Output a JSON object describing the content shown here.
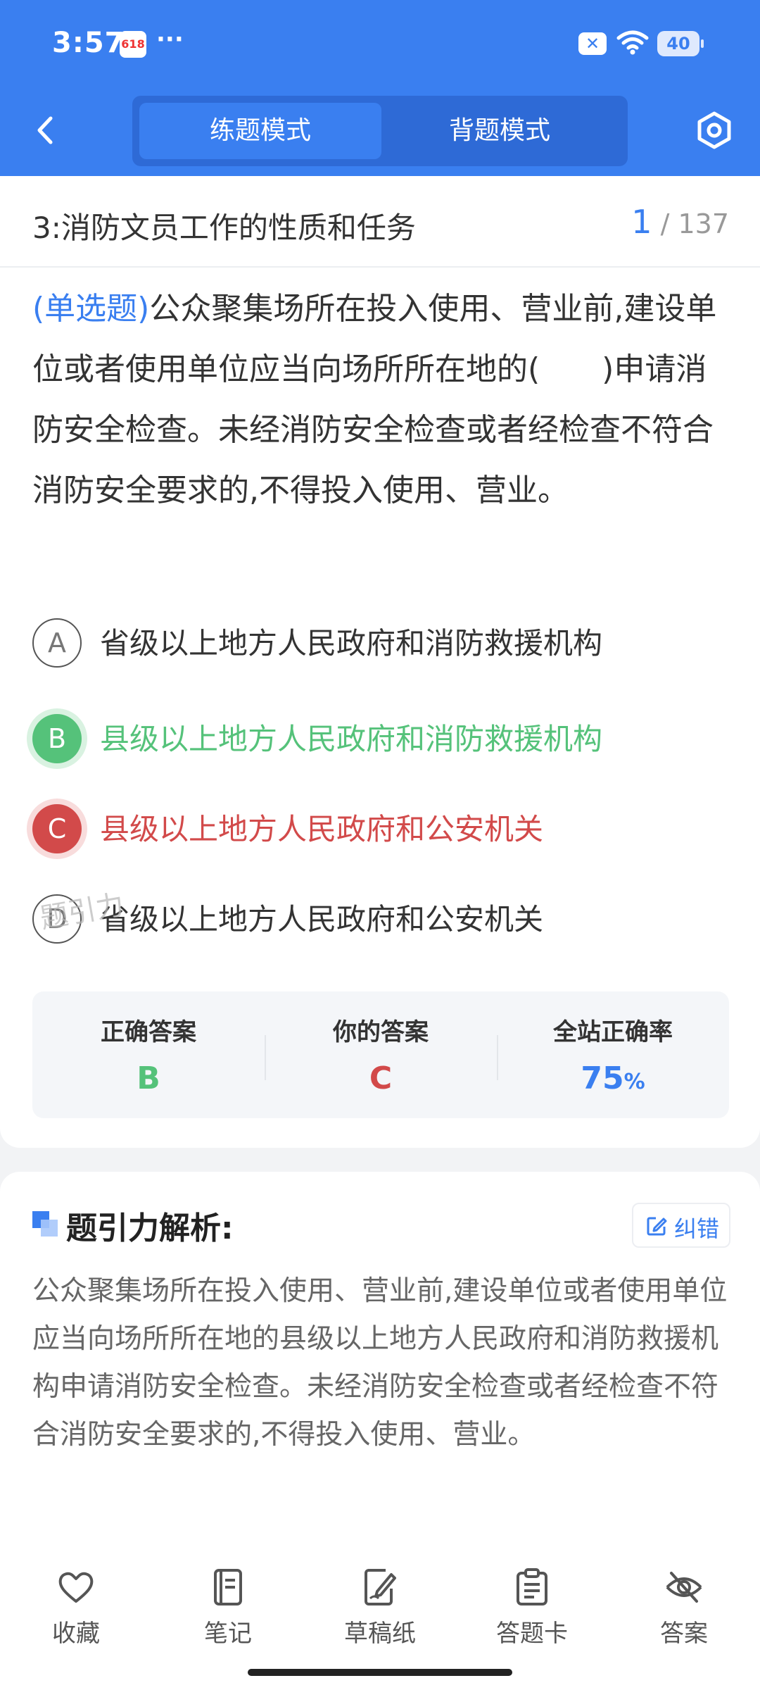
{
  "status_bar": {
    "time": "3:57",
    "app_badge": "618",
    "dots": "···",
    "battery": "40"
  },
  "nav": {
    "tabs": [
      "练题模式",
      "背题模式"
    ],
    "active_tab": "练题模式"
  },
  "chapter": {
    "title": "3:消防文员工作的性质和任务",
    "current": "1",
    "total": "/ 137"
  },
  "question": {
    "type_label": "(单选题)",
    "text": "公众聚集场所在投入使用、营业前,建设单位或者使用单位应当向场所所在地的(　　)申请消防安全检查。未经消防安全检查或者经检查不符合消防安全要求的,不得投入使用、营业。"
  },
  "options": [
    {
      "letter": "A",
      "text": "省级以上地方人民政府和消防救援机构",
      "state": "normal"
    },
    {
      "letter": "B",
      "text": "县级以上地方人民政府和消防救援机构",
      "state": "correct"
    },
    {
      "letter": "C",
      "text": "县级以上地方人民政府和公安机关",
      "state": "wrong"
    },
    {
      "letter": "D",
      "text": "省级以上地方人民政府和公安机关",
      "state": "normal"
    }
  ],
  "watermark": "题引力",
  "answer_summary": {
    "correct_label": "正确答案",
    "correct_value": "B",
    "yours_label": "你的答案",
    "yours_value": "C",
    "rate_label": "全站正确率",
    "rate_value": "75",
    "rate_unit": "%"
  },
  "analysis": {
    "title": "题引力解析:",
    "correct_button": "纠错",
    "text": "公众聚集场所在投入使用、营业前,建设单位或者使用单位应当向场所所在地的县级以上地方人民政府和消防救援机构申请消防安全检查。未经消防安全检查或者经检查不符合消防安全要求的,不得投入使用、营业。"
  },
  "bottom_tabs": [
    {
      "label": "收藏",
      "icon": "heart-icon"
    },
    {
      "label": "笔记",
      "icon": "notebook-icon"
    },
    {
      "label": "草稿纸",
      "icon": "draft-paper-icon"
    },
    {
      "label": "答题卡",
      "icon": "answer-card-icon"
    },
    {
      "label": "答案",
      "icon": "eye-off-icon"
    }
  ],
  "colors": {
    "primary": "#3a7ff0",
    "correct": "#55c27a",
    "wrong": "#d24a4a"
  }
}
